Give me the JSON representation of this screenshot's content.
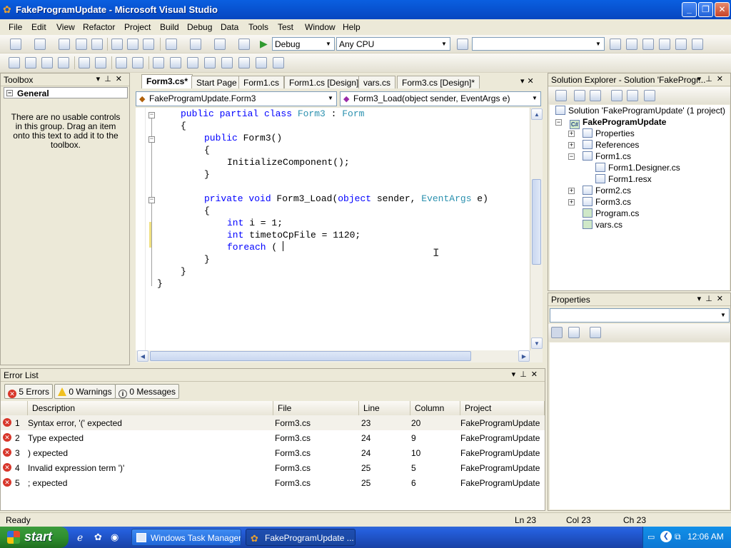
{
  "window": {
    "title": "FakeProgramUpdate - Microsoft Visual Studio",
    "buttons": [
      "_",
      "❐",
      "✕"
    ]
  },
  "menu": [
    "File",
    "Edit",
    "View",
    "Refactor",
    "Project",
    "Build",
    "Debug",
    "Data",
    "Tools",
    "Test",
    "Window",
    "Help"
  ],
  "toolbar": {
    "config": "Debug",
    "platform": "Any CPU",
    "find_value": ""
  },
  "toolbox": {
    "title": "Toolbox",
    "group": "General",
    "message": "There are no usable controls in this group. Drag an item onto this text to add it to the toolbox."
  },
  "editor": {
    "tabs": [
      "Form3.cs*",
      "Start Page",
      "Form1.cs",
      "Form1.cs [Design]",
      "vars.cs",
      "Form3.cs [Design]*"
    ],
    "class_dropdown": "FakeProgramUpdate.Form3",
    "member_dropdown": "Form3_Load(object sender, EventArgs e)",
    "code_lines": [
      "public partial class Form3 : Form",
      "{",
      "public Form3()",
      "{",
      "InitializeComponent();",
      "}",
      "",
      "private void Form3_Load(object sender, EventArgs e)",
      "{",
      "int i = 1;",
      "int timetoCpFile = 1120;",
      "foreach ( ",
      "}",
      "}",
      "}"
    ]
  },
  "solution_explorer": {
    "title": "Solution Explorer - Solution 'FakeProgr...",
    "solution": "Solution 'FakeProgramUpdate' (1 project)",
    "project": "FakeProgramUpdate",
    "items": [
      "Properties",
      "References",
      "Form1.cs",
      "Form1.Designer.cs",
      "Form1.resx",
      "Form2.cs",
      "Form3.cs",
      "Program.cs",
      "vars.cs"
    ]
  },
  "properties": {
    "title": "Properties"
  },
  "error_list": {
    "title": "Error List",
    "filters": {
      "errors": "5 Errors",
      "warnings": "0 Warnings",
      "messages": "0 Messages"
    },
    "columns": [
      "",
      "Description",
      "File",
      "Line",
      "Column",
      "Project"
    ],
    "rows": [
      {
        "num": "1",
        "description": "Syntax error, '(' expected",
        "file": "Form3.cs",
        "line": "23",
        "column": "20",
        "project": "FakeProgramUpdate"
      },
      {
        "num": "2",
        "description": "Type expected",
        "file": "Form3.cs",
        "line": "24",
        "column": "9",
        "project": "FakeProgramUpdate"
      },
      {
        "num": "3",
        "description": ") expected",
        "file": "Form3.cs",
        "line": "24",
        "column": "10",
        "project": "FakeProgramUpdate"
      },
      {
        "num": "4",
        "description": "Invalid expression term ')'",
        "file": "Form3.cs",
        "line": "25",
        "column": "5",
        "project": "FakeProgramUpdate"
      },
      {
        "num": "5",
        "description": "; expected",
        "file": "Form3.cs",
        "line": "25",
        "column": "6",
        "project": "FakeProgramUpdate"
      }
    ]
  },
  "status": {
    "text": "Ready",
    "ln": "Ln 23",
    "col": "Col 23",
    "ch": "Ch 23"
  },
  "taskbar": {
    "start": "start",
    "tasks": [
      "Windows Task Manager",
      "FakeProgramUpdate ..."
    ],
    "clock": "12:06 AM"
  }
}
